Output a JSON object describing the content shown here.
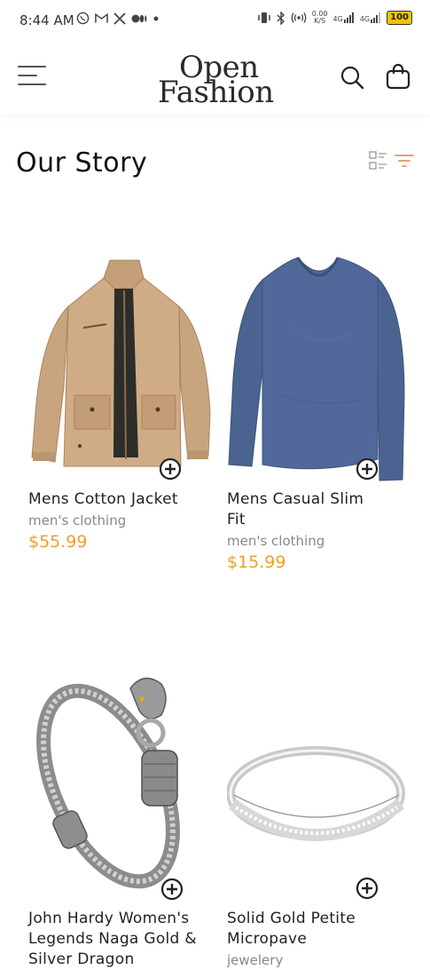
{
  "status_bar": {
    "time": "8:44 AM",
    "left_icons": [
      "whatsapp-icon",
      "gmail-icon",
      "x-icon",
      "medium-icon",
      "dot-icon"
    ],
    "net_rate_top": "0.00",
    "net_rate_bottom": "K/S",
    "sim1": "4G",
    "sim2": "4G",
    "battery": "100"
  },
  "header": {
    "logo_line1": "Open",
    "logo_line2": "Fashion"
  },
  "page": {
    "title": "Our Story"
  },
  "products": [
    {
      "title": "Mens Cotton Jacket",
      "category": "men's clothing",
      "price": "$55.99"
    },
    {
      "title": "Mens Casual Slim Fit",
      "category": "men's clothing",
      "price": "$15.99"
    },
    {
      "title": "John Hardy Women's Legends Naga Gold & Silver Dragon",
      "category": "",
      "price": ""
    },
    {
      "title": "Solid Gold Petite Micropave",
      "category": "jewelery",
      "price": ""
    }
  ],
  "colors": {
    "price": "#e9a12a",
    "filter_accent": "#e8925a",
    "jacket": "#c9a57f",
    "shirt": "#4a6390"
  }
}
